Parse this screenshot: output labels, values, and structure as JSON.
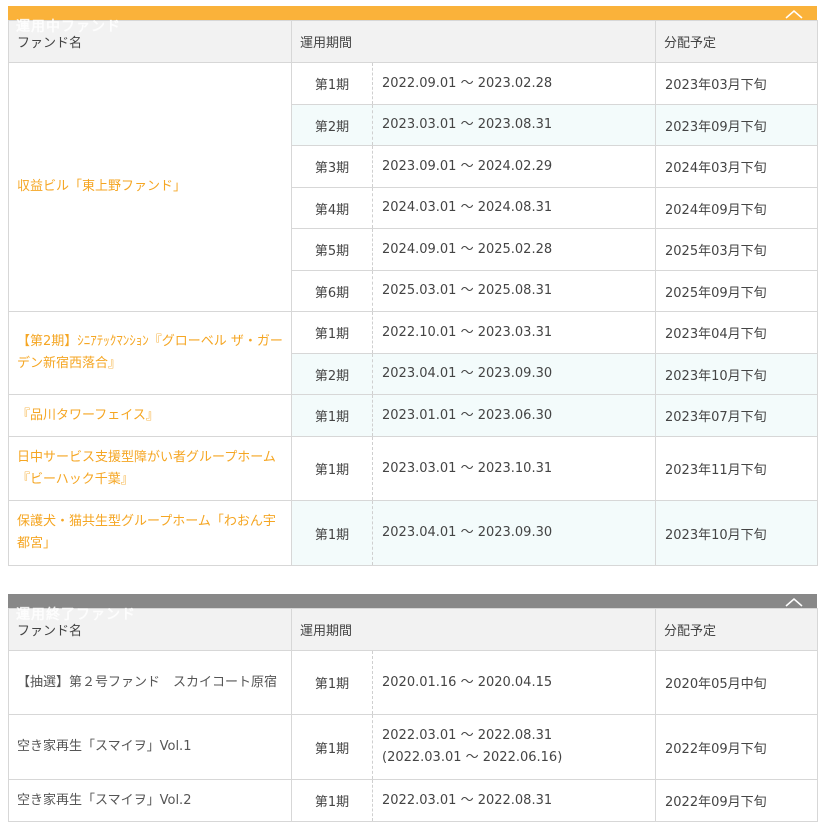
{
  "active": {
    "title": "運用中ファンド",
    "headers": {
      "name": "ファンド名",
      "period": "運用期間",
      "schedule": "分配予定"
    }
  },
  "ended": {
    "title": "運用終了ファンド",
    "headers": {
      "name": "ファンド名",
      "period": "運用期間",
      "schedule": "分配予定"
    }
  },
  "fund1": {
    "name": "収益ビル「東上野ファンド」",
    "rows": [
      {
        "term": "第1期",
        "period": "2022.09.01 ～ 2023.02.28",
        "schedule": "2023年03月下旬"
      },
      {
        "term": "第2期",
        "period": "2023.03.01 ～ 2023.08.31",
        "schedule": "2023年09月下旬"
      },
      {
        "term": "第3期",
        "period": "2023.09.01 ～ 2024.02.29",
        "schedule": "2024年03月下旬"
      },
      {
        "term": "第4期",
        "period": "2024.03.01 ～ 2024.08.31",
        "schedule": "2024年09月下旬"
      },
      {
        "term": "第5期",
        "period": "2024.09.01 ～ 2025.02.28",
        "schedule": "2025年03月下旬"
      },
      {
        "term": "第6期",
        "period": "2025.03.01 ～ 2025.08.31",
        "schedule": "2025年09月下旬"
      }
    ]
  },
  "fund2": {
    "name": "【第2期】ｼﾆｱﾃｯｸﾏﾝｼｮﾝ『グローベル ザ・ガーデン新宿西落合』",
    "rows": [
      {
        "term": "第1期",
        "period": "2022.10.01 ～ 2023.03.31",
        "schedule": "2023年04月下旬"
      },
      {
        "term": "第2期",
        "period": "2023.04.01 ～ 2023.09.30",
        "schedule": "2023年10月下旬"
      }
    ]
  },
  "fund3": {
    "name": "『品川タワーフェイス』",
    "rows": [
      {
        "term": "第1期",
        "period": "2023.01.01 ～ 2023.06.30",
        "schedule": "2023年07月下旬"
      }
    ]
  },
  "fund4": {
    "name": "日中サービス支援型障がい者グループホーム『ビーハック千葉』",
    "rows": [
      {
        "term": "第1期",
        "period": "2023.03.01 ～ 2023.10.31",
        "schedule": "2023年11月下旬"
      }
    ]
  },
  "fund5": {
    "name": "保護犬・猫共生型グループホーム「わおん宇都宮」",
    "rows": [
      {
        "term": "第1期",
        "period": "2023.04.01 ～ 2023.09.30",
        "schedule": "2023年10月下旬"
      }
    ]
  },
  "ended_fund1": {
    "name": "【抽選】第２号ファンド　スカイコート原宿",
    "rows": [
      {
        "term": "第1期",
        "period": "2020.01.16 ～ 2020.04.15",
        "schedule": "2020年05月中旬"
      }
    ]
  },
  "ended_fund2": {
    "name": "空き家再生「スマイヲ」Vol.1",
    "rows": [
      {
        "term": "第1期",
        "period": "2022.03.01 ～ 2022.08.31",
        "period_note": "(2022.03.01 ～ 2022.06.16)",
        "schedule": "2022年09月下旬"
      }
    ]
  },
  "ended_fund3": {
    "name": "空き家再生「スマイヲ」Vol.2",
    "rows": [
      {
        "term": "第1期",
        "period": "2022.03.01 ～ 2022.08.31",
        "schedule": "2022年09月下旬"
      }
    ]
  },
  "colors": {
    "active_accent": "#fab23a",
    "ended_accent": "#888888",
    "fund_link": "#f5a623",
    "alt_row": "#f3fbfb"
  },
  "icons": {
    "toggle": "chevron-up-icon"
  }
}
